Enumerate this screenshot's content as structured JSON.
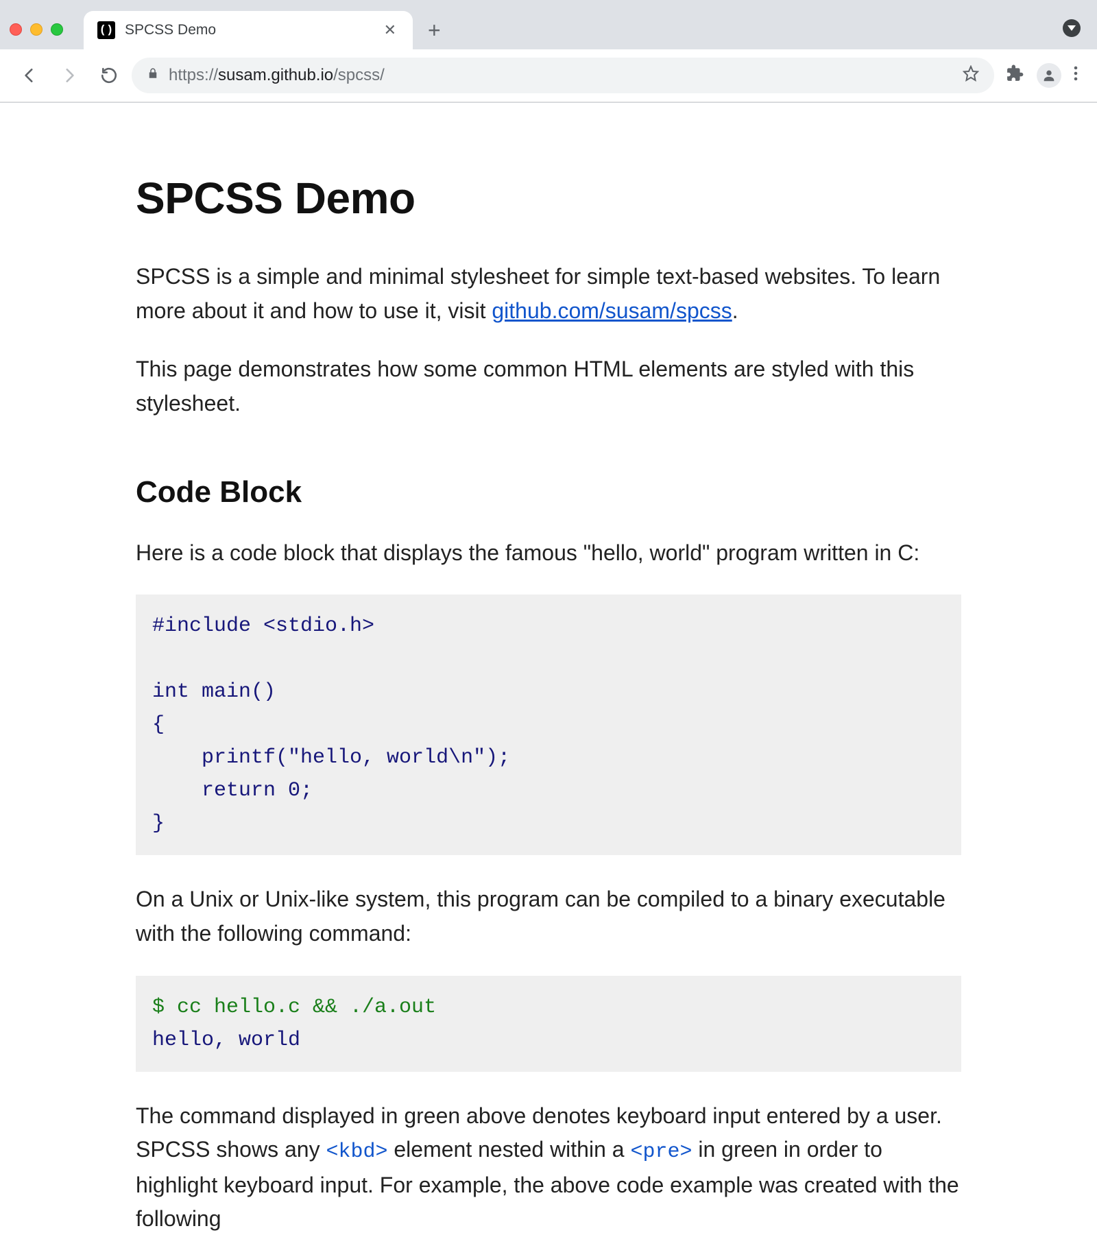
{
  "browser": {
    "tab_title": "SPCSS Demo",
    "favicon_glyph": "()",
    "new_tab_label": "+",
    "url_scheme": "https://",
    "url_host": "susam.github.io",
    "url_path": "/spcss/"
  },
  "page": {
    "h1": "SPCSS Demo",
    "intro_pre": "SPCSS is a simple and minimal stylesheet for simple text-based websites. To learn more about it and how to use it, visit ",
    "intro_link": "github.com/susam/spcss",
    "intro_post": ".",
    "intro2": "This page demonstrates how some common HTML elements are styled with this stylesheet.",
    "h2_code": "Code Block",
    "code_intro": "Here is a code block that displays the famous \"hello, world\" program written in C:",
    "code_c": "#include <stdio.h>\n\nint main()\n{\n    printf(\"hello, world\\n\");\n    return 0;\n}",
    "compile_intro": "On a Unix or Unix-like system, this program can be compiled to a binary executable with the following command:",
    "shell_kbd": "$ cc hello.c && ./a.out",
    "shell_out": "hello, world",
    "explain_pre": "The command displayed in green above denotes keyboard input entered by a user. SPCSS shows any ",
    "explain_kbd": "<kbd>",
    "explain_mid": " element nested within a ",
    "explain_pre_el": "<pre>",
    "explain_post": " in green in order to highlight keyboard input. For example, the above code example was created with the following"
  }
}
